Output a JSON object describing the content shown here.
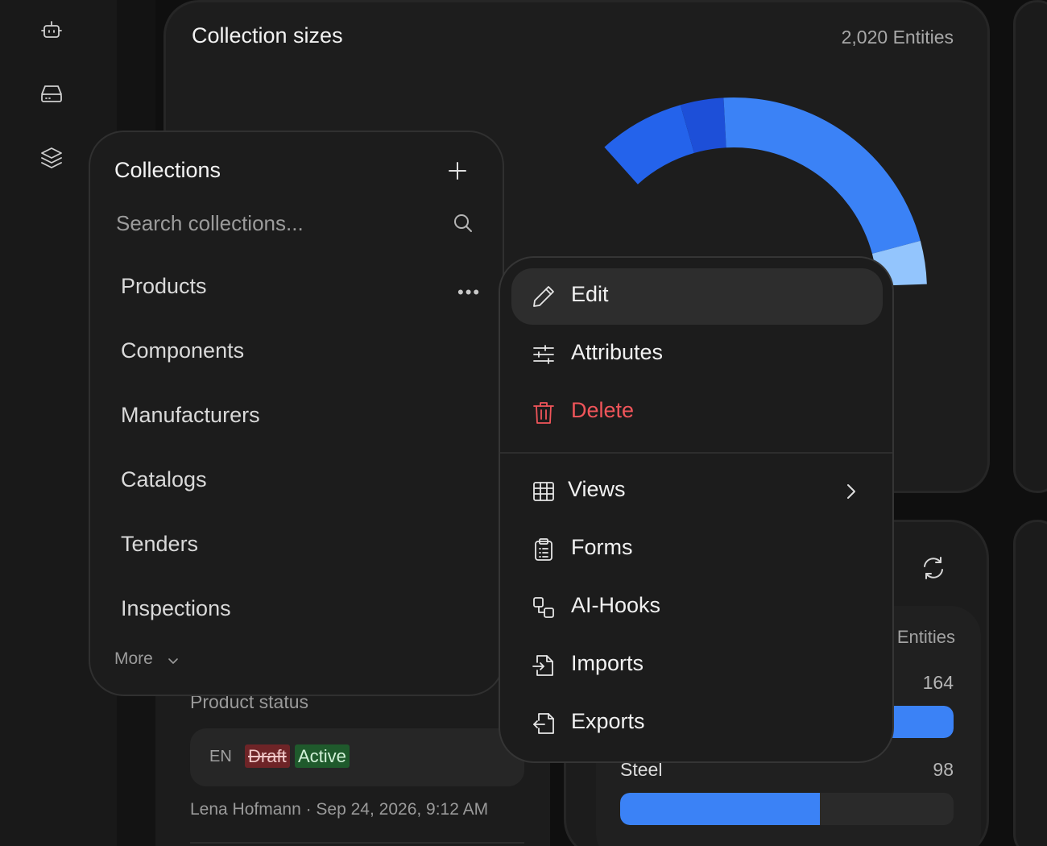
{
  "rail": {
    "icons": [
      "bot-icon",
      "drive-icon",
      "layers-icon"
    ]
  },
  "chart": {
    "title": "Collection sizes",
    "meta": "2,020 Entities"
  },
  "chart_data": {
    "type": "pie",
    "title": "Collection sizes",
    "colors": [
      "#2463eb",
      "#1d4fd8",
      "#3b82f6",
      "#93c5fd"
    ]
  },
  "collections": {
    "title": "Collections",
    "search_placeholder": "Search collections...",
    "items": [
      "Products",
      "Components",
      "Manufacturers",
      "Catalogs",
      "Tenders",
      "Inspections"
    ],
    "more_label": "More"
  },
  "context_menu": {
    "items": [
      {
        "label": "Edit",
        "icon": "pencil-icon"
      },
      {
        "label": "Attributes",
        "icon": "sliders-icon"
      },
      {
        "label": "Delete",
        "icon": "trash-icon"
      },
      {
        "label": "Views",
        "icon": "table-icon"
      },
      {
        "label": "Forms",
        "icon": "clipboard-icon"
      },
      {
        "label": "AI-Hooks",
        "icon": "hooks-icon"
      },
      {
        "label": "Imports",
        "icon": "import-icon"
      },
      {
        "label": "Exports",
        "icon": "export-icon"
      }
    ]
  },
  "product_status": {
    "label": "Product status",
    "lang": "EN",
    "old_value": "Draft",
    "new_value": "Active",
    "meta": "Lena Hofmann · Sep 24, 2026, 9:12 AM"
  },
  "entities": {
    "header": "Entities",
    "rows": [
      {
        "label": "",
        "count": "164",
        "fraction": 1.0
      },
      {
        "label": "Steel",
        "count": "98",
        "fraction": 0.6
      }
    ]
  },
  "colors": {
    "accent": "#3b82f6",
    "danger": "#f0555a",
    "background": "#0f0f0f"
  }
}
